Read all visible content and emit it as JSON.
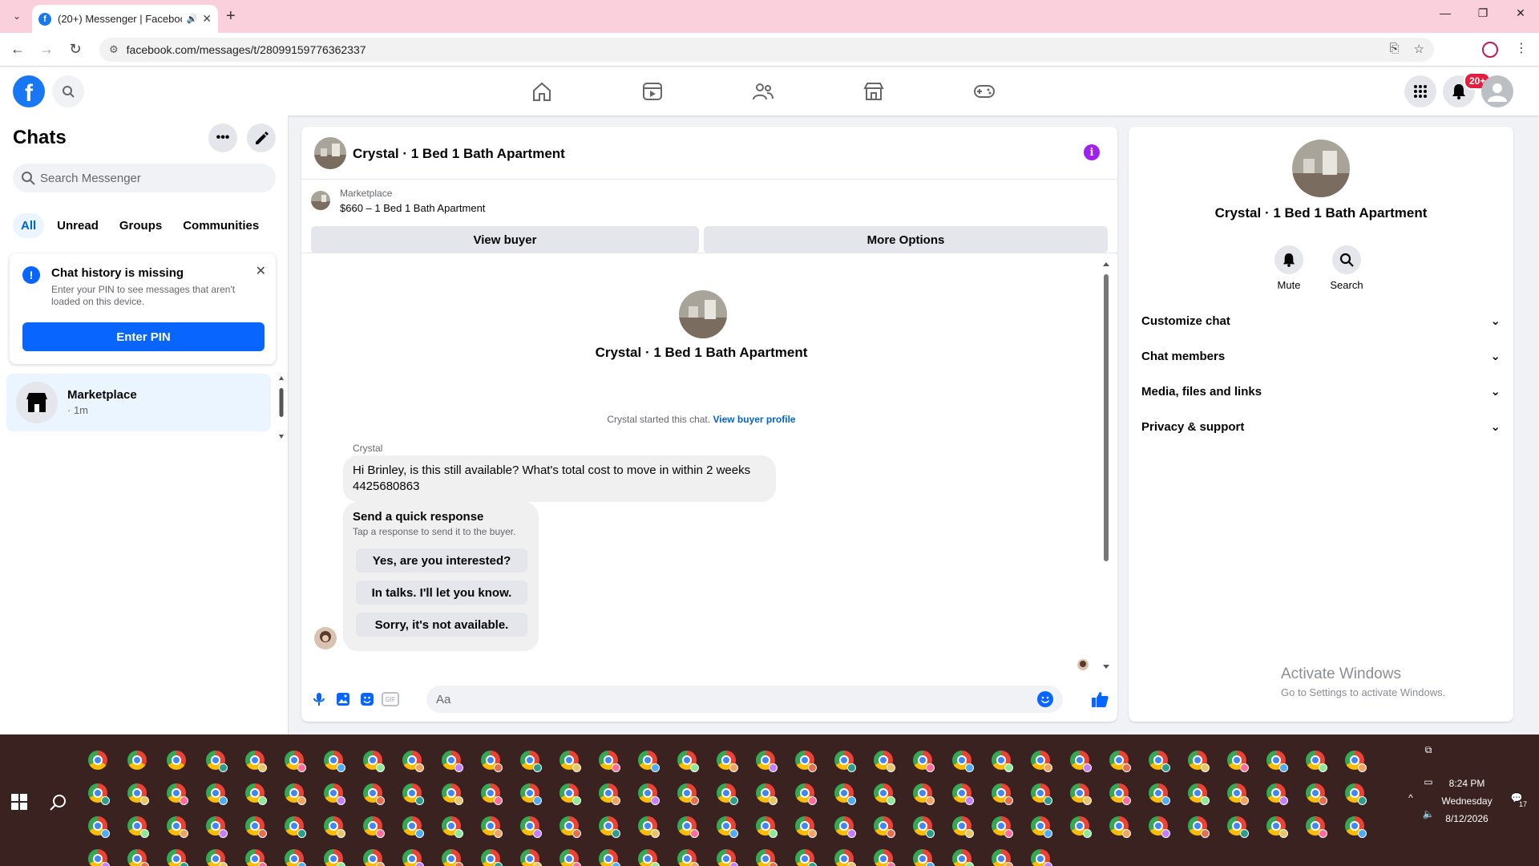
{
  "browser": {
    "tab_title": "(20+) Messenger | Faceboo",
    "url": "facebook.com/messages/t/28099159776362337"
  },
  "fb": {
    "notif_count": "20+",
    "logo_letter": "f"
  },
  "sidebar": {
    "title": "Chats",
    "search_placeholder": "Search Messenger",
    "filters": [
      "All",
      "Unread",
      "Groups",
      "Communities"
    ],
    "history": {
      "title": "Chat history is missing",
      "text": "Enter your PIN to see messages that aren't loaded on this device.",
      "button": "Enter PIN"
    },
    "conversation": {
      "name": "Marketplace",
      "time": "· 1m"
    }
  },
  "chat": {
    "title": "Crystal · 1 Bed 1 Bath Apartment",
    "marketplace_label": "Marketplace",
    "listing": "$660 – 1 Bed 1 Bath Apartment",
    "view_buyer": "View buyer",
    "more_options": "More Options",
    "intro_name": "Crystal · 1 Bed 1 Bath Apartment",
    "started_text": "Crystal started this chat.",
    "view_buyer_profile": "View buyer profile",
    "sender": "Crystal",
    "message_line1": "Hi Brinley, is this still available? What's total cost to move in within 2 weeks",
    "message_line2": "4425680863",
    "quick_title": "Send a quick response",
    "quick_sub": "Tap a response to send it to the buyer.",
    "quick_replies": [
      "Yes, are you interested?",
      "In talks. I'll let you know.",
      "Sorry, it's not available."
    ],
    "composer_placeholder": "Aa",
    "gif_label": "GIF"
  },
  "info": {
    "name": "Crystal · 1 Bed 1 Bath Apartment",
    "mute": "Mute",
    "search": "Search",
    "rows": [
      "Customize chat",
      "Chat members",
      "Media, files and links",
      "Privacy & support"
    ],
    "watermark_title": "Activate Windows",
    "watermark_sub": "Go to Settings to activate Windows."
  },
  "taskbar": {
    "time": "8:24 PM",
    "day": "Wednesday",
    "date": "8/12/2026",
    "notif": "17"
  },
  "colors": {
    "accent": "#0866ff",
    "tabbar": "#f9d0dc",
    "taskbar": "#3a2221",
    "info_purple": "#a020f0"
  }
}
